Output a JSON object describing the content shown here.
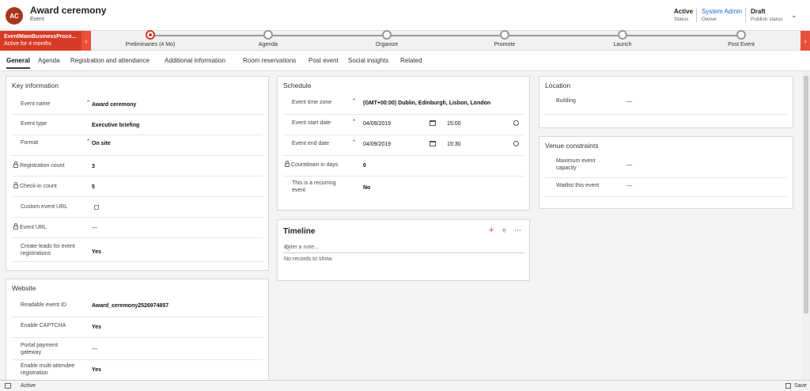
{
  "header": {
    "avatar_initials": "AC",
    "title": "Award ceremony",
    "entity": "Event",
    "status_value": "Active",
    "status_label": "Status",
    "owner_value": "System Admin",
    "owner_label": "Owner",
    "publish_value": "Draft",
    "publish_label": "Publish status"
  },
  "bpf": {
    "process_name": "EventMainBusinessProce...",
    "active_for": "Active for 4 months",
    "stages": [
      {
        "label": "Preliminaries  (4 Mo)",
        "active": true
      },
      {
        "label": "Agenda"
      },
      {
        "label": "Organize"
      },
      {
        "label": "Promote"
      },
      {
        "label": "Launch"
      },
      {
        "label": "Post Event"
      }
    ]
  },
  "tabs": [
    "General",
    "Agenda",
    "Registration and attendance",
    "Additional information",
    "Room reservations",
    "Post event",
    "Social insights",
    "Related"
  ],
  "key_info": {
    "title": "Key information",
    "event_name_label": "Event name",
    "event_name": "Award ceremony",
    "event_type_label": "Event type",
    "event_type": "Executive briefing",
    "format_label": "Format",
    "format": "On site",
    "reg_count_label": "Registration count",
    "reg_count": "3",
    "checkin_label": "Check-in count",
    "checkin": "5",
    "custom_url_label": "Custom event URL",
    "event_url_label": "Event URL",
    "event_url": "---",
    "create_leads_label": "Create leads for event registrations",
    "create_leads": "Yes"
  },
  "website": {
    "title": "Website",
    "readable_id_label": "Readable event ID",
    "readable_id": "Award_ceremony2526974857",
    "captcha_label": "Enable CAPTCHA",
    "captcha": "Yes",
    "portal_label": "Portal payment gateway",
    "portal": "---",
    "multi_label": "Enable multi-attendee registration",
    "multi": "Yes"
  },
  "schedule": {
    "title": "Schedule",
    "tz_label": "Event time zone",
    "tz": "(GMT+00:00) Dublin, Edinburgh, Lisbon, London",
    "start_label": "Event start date",
    "start_date": "04/09/2019",
    "start_time": "15:00",
    "end_label": "Event end date",
    "end_date": "04/09/2019",
    "end_time": "15:30",
    "countdown_label": "Countdown in days",
    "countdown": "0",
    "recurring_label": "This is a recurring event",
    "recurring": "No"
  },
  "timeline": {
    "title": "Timeline",
    "note_placeholder": "Enter a note...",
    "empty": "No records to show."
  },
  "location": {
    "title": "Location",
    "building_label": "Building",
    "building": "---"
  },
  "venue": {
    "title": "Venue constraints",
    "capacity_label": "Maximum event capacity",
    "capacity": "---",
    "waitlist_label": "Waitlist this event",
    "waitlist": "---"
  },
  "footer": {
    "status": "Active",
    "save": "Save"
  },
  "colors": {
    "accent": "#d83b25",
    "link": "#2266cc"
  }
}
